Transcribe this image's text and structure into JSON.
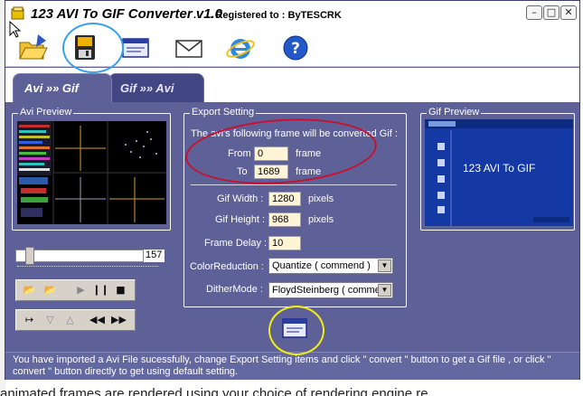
{
  "window": {
    "title": "123 AVI To GIF Converter v1.0",
    "registration": ". . . . Registered to :  ByTESCRK"
  },
  "tabs": [
    {
      "label": "Avi »» Gif",
      "active": true
    },
    {
      "label": "Gif »» Avi",
      "active": false
    }
  ],
  "avi_preview": {
    "label": "Avi Preview"
  },
  "slider": {
    "position_label": "157"
  },
  "export": {
    "label": "Export  Setting",
    "intro": "The avi's following frame will be converted Gif :",
    "from_label": "From",
    "from_value": "0",
    "to_label": "To",
    "to_value": "1689",
    "frame_unit": "frame",
    "gif_width_label": "Gif Width :",
    "gif_width_value": "1280",
    "gif_height_label": "Gif Height :",
    "gif_height_value": "968",
    "pixels_unit": "pixels",
    "frame_delay_label": "Frame Delay :",
    "frame_delay_value": "10",
    "color_reduction_label": "ColorReduction :",
    "color_reduction_value": "Quantize  ( commend )",
    "dither_label": "DitherMode :",
    "dither_value": "FloydSteinberg ( commend )"
  },
  "gif_preview": {
    "label": "Gif Preview",
    "banner_title": "123 AVI To GIF"
  },
  "status": {
    "message": "You have imported a Avi File sucessfully, change Export Setting  items and click \" convert \" button to get a Gif file , or click \" convert \" button directly to get using default setting."
  },
  "background": {
    "bottom_text": "animated frames are rendered using your choice of rendering engine re"
  },
  "colors": {
    "panel": "#5d6197",
    "annotation_red": "#c8102e",
    "annotation_yellow": "#f2ee10",
    "annotation_blue": "#3aa0ea"
  },
  "icons": [
    "open-folder-icon",
    "save-disk-icon",
    "convert-window-icon",
    "mail-icon",
    "internet-explorer-icon",
    "help-icon"
  ]
}
